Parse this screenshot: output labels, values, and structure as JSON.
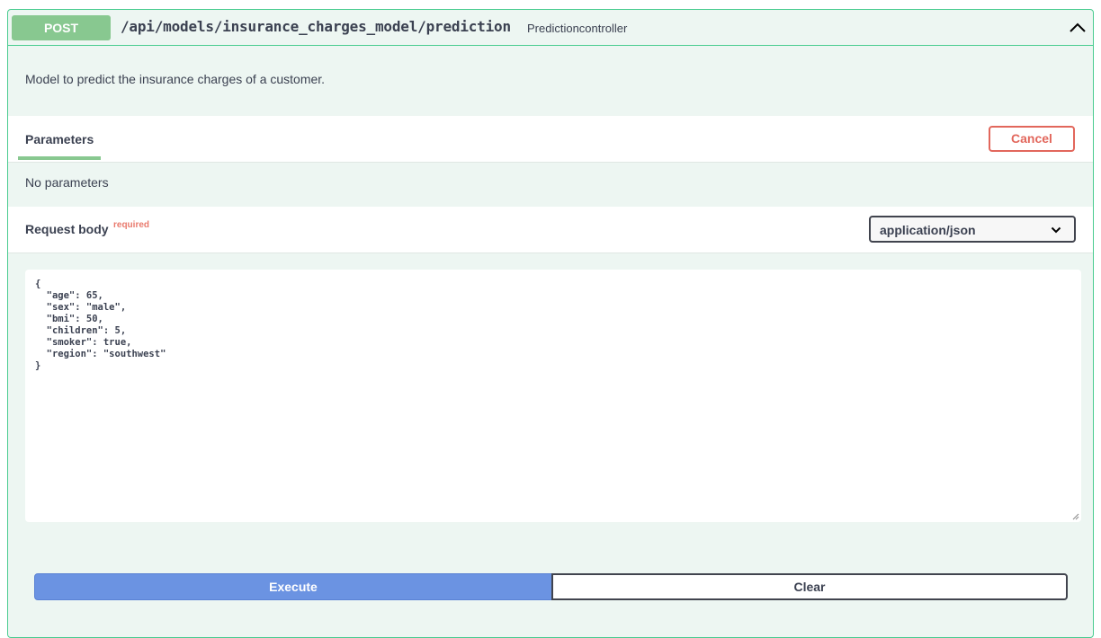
{
  "operation": {
    "method": "POST",
    "path": "/api/models/insurance_charges_model/prediction",
    "controller": "Predictioncontroller",
    "description": "Model to predict the insurance charges of a customer."
  },
  "parameters": {
    "tab_label": "Parameters",
    "cancel_label": "Cancel",
    "empty_text": "No parameters"
  },
  "request_body": {
    "title": "Request body",
    "required_label": "required",
    "content_type": "application/json",
    "body": "{\n  \"age\": 65,\n  \"sex\": \"male\",\n  \"bmi\": 50,\n  \"children\": 5,\n  \"smoker\": true,\n  \"region\": \"southwest\"\n}"
  },
  "actions": {
    "execute_label": "Execute",
    "clear_label": "Clear"
  },
  "colors": {
    "post_method": "#88c890",
    "border": "#49cc90",
    "panel_bg": "#edf6f2",
    "cancel": "#e2675c",
    "execute": "#6b93e2"
  },
  "icons": {
    "collapse": "chevron-up-icon",
    "select": "chevron-down-icon"
  }
}
